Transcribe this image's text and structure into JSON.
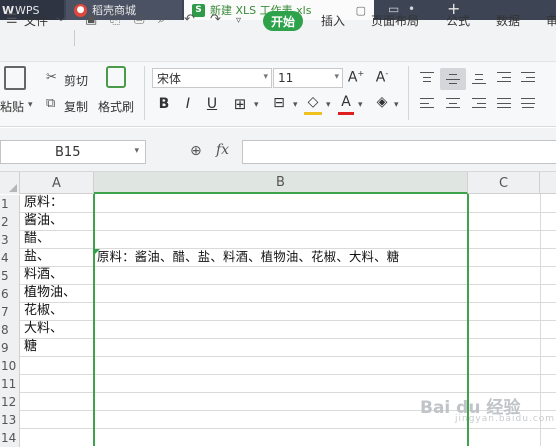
{
  "titlebar": {
    "tabs": [
      {
        "label": "WPS"
      },
      {
        "label": "稻壳商城"
      },
      {
        "label": "新建 XLS 工作表.xls"
      }
    ],
    "new_tab_label": "+"
  },
  "menubar": {
    "file_label": "文件",
    "items": [
      "开始",
      "插入",
      "页面布局",
      "公式",
      "数据",
      "审"
    ]
  },
  "ribbon": {
    "paste_label": "粘贴",
    "cut_label": "剪切",
    "copy_label": "复制",
    "format_painter_label": "格式刷",
    "font_name": "宋体",
    "font_size": "11",
    "bold_label": "B",
    "italic_label": "I",
    "underline_label": "U",
    "font_color_hex": "#e02020",
    "fill_color_hex": "#f0c020"
  },
  "formula_bar": {
    "name_box": "B15",
    "fx_label": "fx",
    "formula": ""
  },
  "sheet": {
    "columns": [
      "A",
      "B",
      "C"
    ],
    "row_numbers": [
      "1",
      "2",
      "3",
      "4",
      "5",
      "6",
      "7",
      "8",
      "9",
      "10",
      "11",
      "12",
      "13",
      "14"
    ],
    "column_a": [
      "原料：",
      "酱油、",
      "醋、",
      "盐、",
      "料酒、",
      "植物油、",
      "花椒、",
      "大料、",
      "糖"
    ],
    "b4": "原料：酱油、醋、盐、料酒、植物油、花椒、大料、糖",
    "accent_color": "#3ca34a"
  },
  "watermark": {
    "text": "Bai du 经验",
    "sub": "jingyan.baidu.com"
  }
}
